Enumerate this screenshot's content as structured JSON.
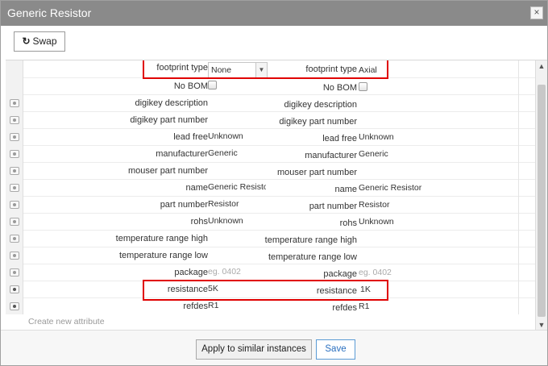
{
  "window": {
    "title": "Generic Resistor",
    "close_glyph": "×"
  },
  "toolbar": {
    "swap_icon": "↻",
    "swap_label": "Swap"
  },
  "rows": [
    {
      "label_left": "footprint type",
      "value_left": "None",
      "label_right": "footprint type",
      "value_right": "Axial"
    },
    {
      "label_left": "No BOM",
      "label_right": "No BOM"
    },
    {
      "label_left": "digikey description",
      "value_left": "",
      "label_right": "digikey description",
      "value_right": ""
    },
    {
      "label_left": "digikey part number",
      "value_left": "",
      "label_right": "digikey part number",
      "value_right": ""
    },
    {
      "label_left": "lead free",
      "value_left": "Unknown",
      "label_right": "lead free",
      "value_right": "Unknown"
    },
    {
      "label_left": "manufacturer",
      "value_left": "Generic",
      "label_right": "manufacturer",
      "value_right": "Generic"
    },
    {
      "label_left": "mouser part number",
      "value_left": "",
      "label_right": "mouser part number",
      "value_right": ""
    },
    {
      "label_left": "name",
      "value_left": "Generic Resisto",
      "label_right": "name",
      "value_right": "Generic Resistor"
    },
    {
      "label_left": "part number",
      "value_left": "Resistor",
      "label_right": "part number",
      "value_right": "Resistor"
    },
    {
      "label_left": "rohs",
      "value_left": "Unknown",
      "label_right": "rohs",
      "value_right": "Unknown"
    },
    {
      "label_left": "temperature range high",
      "value_left": "",
      "label_right": "temperature range high",
      "value_right": ""
    },
    {
      "label_left": "temperature range low",
      "value_left": "",
      "label_right": "temperature range low",
      "value_right": ""
    },
    {
      "label_left": "package",
      "placeholder_left": "eg. 0402",
      "label_right": "package",
      "placeholder_right": "eg. 0402"
    },
    {
      "label_left": "resistance",
      "value_left": "5K",
      "label_right": "resistance",
      "value_right": "1K"
    },
    {
      "label_left": "refdes",
      "value_left": "R1",
      "label_right": "refdes",
      "value_right": "R1"
    }
  ],
  "create_attribute_placeholder": "Create new attribute",
  "footer": {
    "apply_label": "Apply to similar instances",
    "save_label": "Save"
  },
  "colors": {
    "titlebar": "#8a8a8a",
    "highlight": "#e00000",
    "save_accent": "#2a6fbf"
  }
}
